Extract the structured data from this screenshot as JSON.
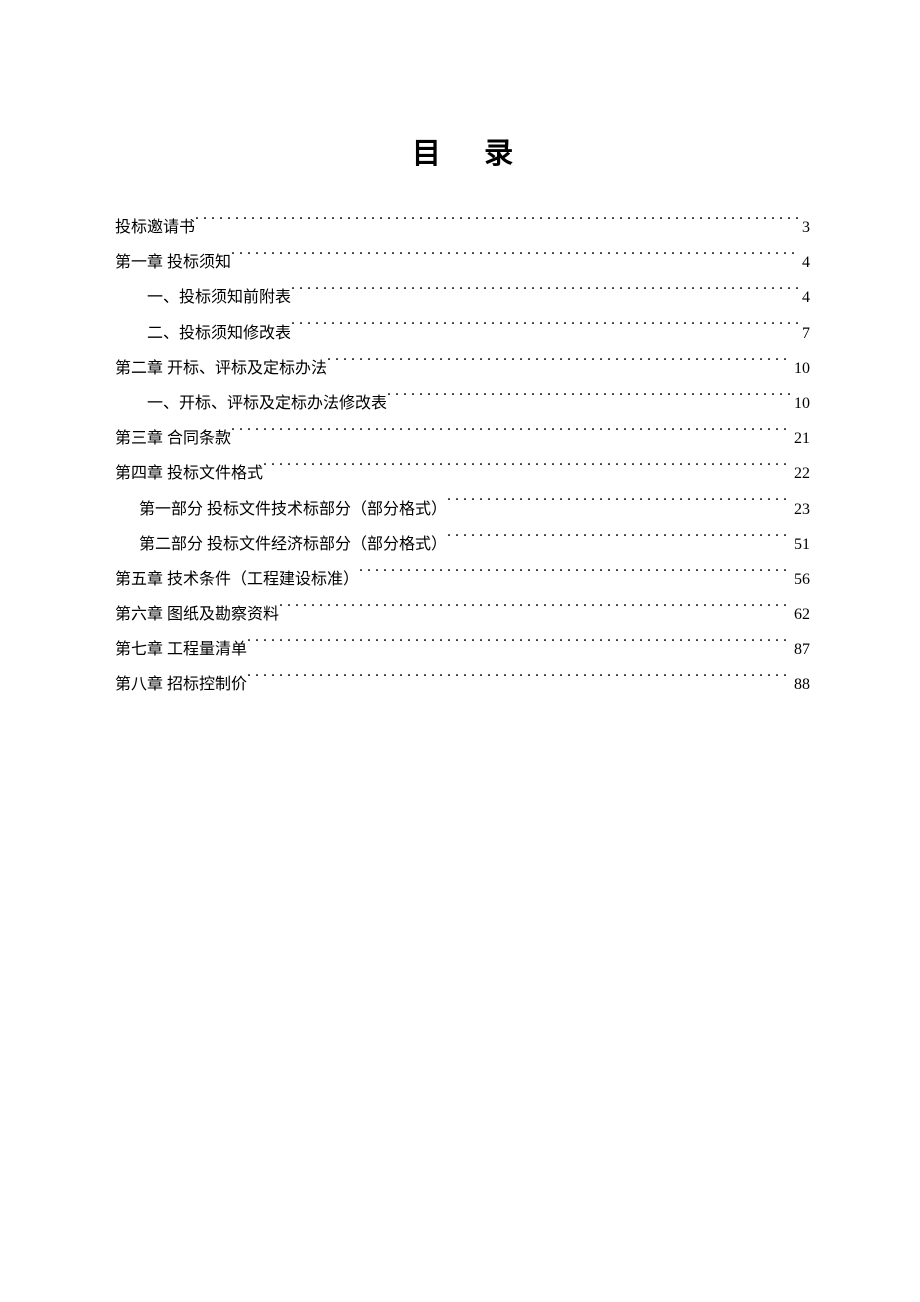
{
  "title": "目 录",
  "toc": [
    {
      "indent": "indent-0",
      "label": "投标邀请书",
      "page": "3"
    },
    {
      "indent": "indent-0",
      "label": "第一章  投标须知",
      "page": "4"
    },
    {
      "indent": "indent-1",
      "label": "一、投标须知前附表",
      "page": "4"
    },
    {
      "indent": "indent-1",
      "label": "二、投标须知修改表",
      "page": "7"
    },
    {
      "indent": "indent-0",
      "label": "第二章  开标、评标及定标办法",
      "page": "10"
    },
    {
      "indent": "indent-1",
      "label": "一、开标、评标及定标办法修改表",
      "page": "10"
    },
    {
      "indent": "indent-0",
      "label": "第三章  合同条款",
      "page": "21"
    },
    {
      "indent": "indent-0",
      "label": "第四章  投标文件格式",
      "page": "22"
    },
    {
      "indent": "indent-part",
      "label": "第一部分  投标文件技术标部分（部分格式）",
      "page": "23"
    },
    {
      "indent": "indent-part",
      "label": "第二部分  投标文件经济标部分（部分格式）",
      "page": "51"
    },
    {
      "indent": "indent-0",
      "label": "第五章  技术条件（工程建设标准）",
      "page": "56"
    },
    {
      "indent": "indent-0",
      "label": "第六章  图纸及勘察资料",
      "page": "62"
    },
    {
      "indent": "indent-0",
      "label": "第七章  工程量清单",
      "page": "87"
    },
    {
      "indent": "indent-0",
      "label": "第八章  招标控制价",
      "page": "88"
    }
  ]
}
